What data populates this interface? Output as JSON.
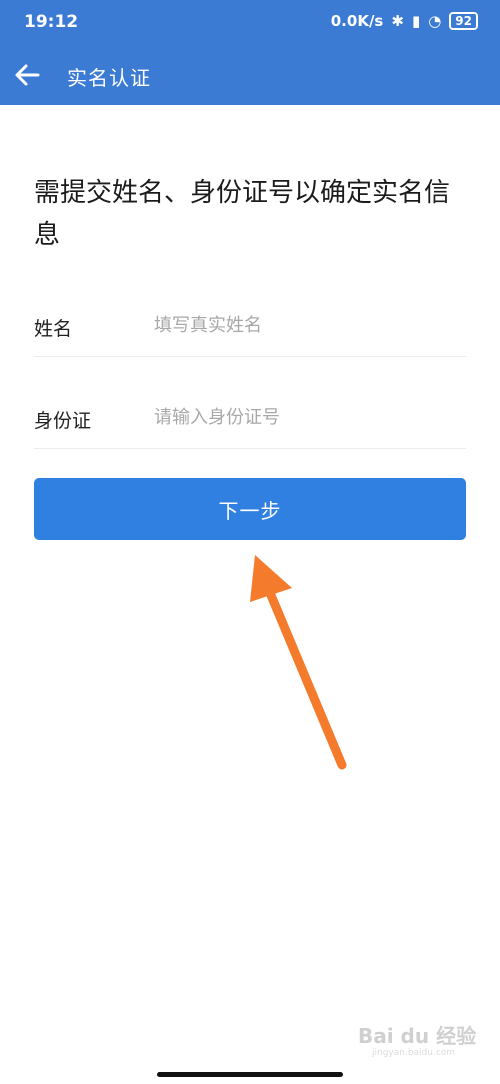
{
  "status_bar": {
    "time": "19:12",
    "speed": "0.0K/s",
    "battery": "92"
  },
  "toolbar": {
    "title": "实名认证"
  },
  "main": {
    "heading": "需提交姓名、身份证号以确定实名信息",
    "fields": [
      {
        "label": "姓名",
        "placeholder": "填写真实姓名",
        "value": ""
      },
      {
        "label": "身份证",
        "placeholder": "请输入身份证号",
        "value": ""
      }
    ],
    "next_label": "下一步"
  },
  "watermark": {
    "text": "Bai du 经验",
    "sub": "jingyan.baidu.com"
  },
  "colors": {
    "appbar": "#3b7bd4",
    "button": "#2f80e0",
    "annotation_arrow": "#f47a2c"
  }
}
